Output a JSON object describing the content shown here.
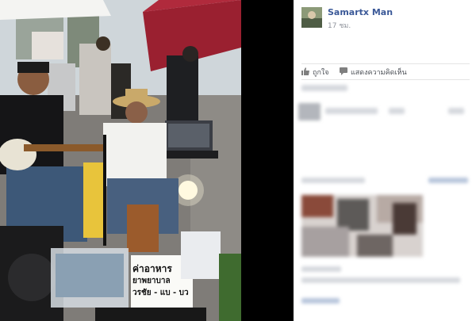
{
  "post": {
    "author": "Samartx Man",
    "time": "17 ชม."
  },
  "actions": {
    "like_label": "ถูกใจ",
    "like_icon": "thumbs-up-icon",
    "comment_label": "แสดงความคิดเห็น",
    "comment_icon": "speech-bubble-icon"
  },
  "colors": {
    "link": "#3b5998",
    "meta": "#90949c",
    "action_text": "#4b4f56",
    "panel_bg": "#ffffff",
    "page_bg": "#000000"
  },
  "photo": {
    "sign_text_lines": [
      "ค่าอาหาร",
      "ยาพยาบาล",
      "วรชัย - แบ - บว"
    ]
  }
}
